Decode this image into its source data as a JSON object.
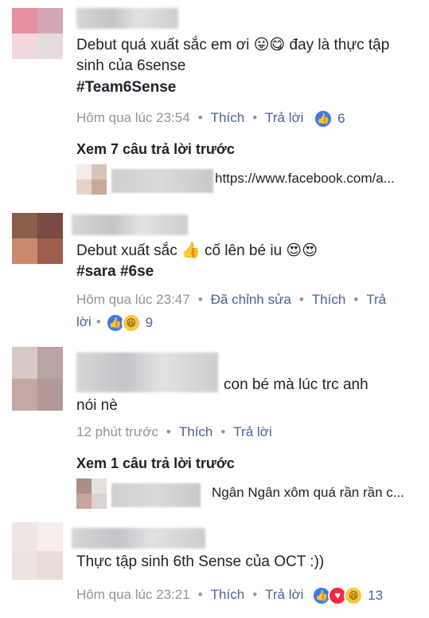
{
  "comments": [
    {
      "text": "Debut quá xuất sắc em ơi 😛😋 đay là thực tập sinh của 6sense",
      "hashtags": "#Team6Sense",
      "time": "Hôm qua lúc 23:54",
      "like": "Thích",
      "reply": "Trả lời",
      "reaction_count": "6",
      "view_more": "Xem 7 câu trả lời trước",
      "reply_preview": "https://www.facebook.com/a..."
    },
    {
      "text": "Debut xuất sắc 👍 cố lên bé iu 😍😍",
      "hashtags": "#sara #6se",
      "time": "Hôm qua lúc 23:47",
      "edited": "Đã chỉnh sửa",
      "like": "Thích",
      "reply_a": "Trả",
      "reply_b": "lời",
      "reaction_count": "9"
    },
    {
      "text": "con bé mà lúc trc anh",
      "text2": "nói nè",
      "time": "12 phút trước",
      "like": "Thích",
      "reply": "Trả lời",
      "view_more": "Xem 1 câu trả lời trước",
      "reply_preview": "Ngân Ngân xôm quá rần rần c..."
    },
    {
      "text": "Thực tập sinh 6th Sense của OCT :))",
      "time": "Hôm qua lúc 23:21",
      "like": "Thích",
      "reply": "Trả lời",
      "reaction_count": "13"
    }
  ],
  "colors": {
    "link": "#4b6399",
    "meta": "#90949c",
    "hashtag": "#365899",
    "like_blue": "#3b79f5"
  },
  "icons": [
    "like-icon",
    "haha-icon",
    "love-icon",
    "thumbs-up-icon"
  ]
}
